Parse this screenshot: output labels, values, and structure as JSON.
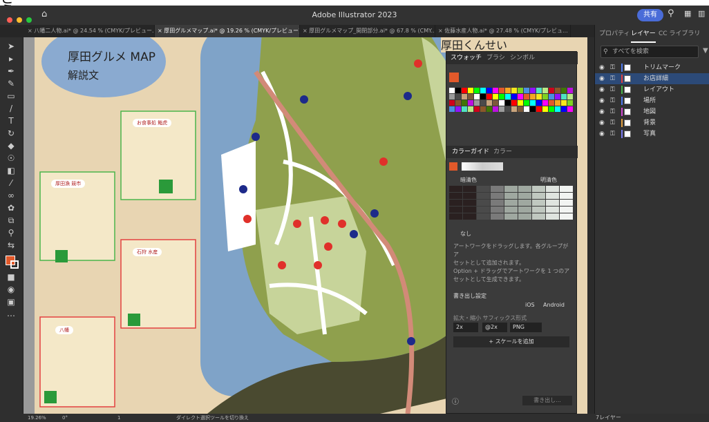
{
  "crop_text": "さう。",
  "app": {
    "title": "Adobe Illustrator 2023",
    "share_label": "共有"
  },
  "tabs": [
    {
      "label": "八幡二人物.ai* @ 24.54 % (CMYK/プレビュー...",
      "active": false
    },
    {
      "label": "厚田グルメマップ.ai* @ 19.26 % (CMYK/プレビュー)",
      "active": true
    },
    {
      "label": "厚田グルメマップ_開閉部分.ai* @ 67.8 % (CMY...",
      "active": false
    },
    {
      "label": "佐藤水産人物.ai* @ 27.48 % (CMYK/プレビュ...",
      "active": false
    }
  ],
  "right_panel": {
    "tabs": [
      "プロパティ",
      "レイヤー",
      "CC ライブラリ"
    ],
    "search_placeholder": "すべてを検索",
    "layers": [
      {
        "name": "トリムマーク",
        "color": "#4f7bf0",
        "selected": false
      },
      {
        "name": "お店詳細",
        "color": "#e34040",
        "selected": true
      },
      {
        "name": "レイアウト",
        "color": "#4ab54a",
        "selected": false
      },
      {
        "name": "場所",
        "color": "#4f7bf0",
        "selected": false
      },
      {
        "name": "地図",
        "color": "#d44ad4",
        "selected": false
      },
      {
        "name": "背景",
        "color": "#e3a040",
        "selected": false
      },
      {
        "name": "写真",
        "color": "#7b7bf0",
        "selected": false
      }
    ],
    "layer_count": "7レイヤー"
  },
  "swatch_panel": {
    "tabs": [
      "スウォッチ",
      "ブラシ",
      "シンボル"
    ],
    "color_guide_tabs": [
      "カラーガイド",
      "カラー"
    ],
    "dark_label": "暗清色",
    "light_label": "明清色",
    "none_label": "なし",
    "info_text1": "アートワークをドラッグします。各グループがア\nセットとして追加されます。",
    "info_text2": "Option + ドラッグでアートワークを 1 つのア\nセットとして生成できます。",
    "export_title": "書き出し設定",
    "ios": "iOS",
    "android": "Android",
    "scale_header": "拡大・縮小  サフィックス形式",
    "scale_value": "2x",
    "suffix_value": "@2x",
    "format_value": "PNG",
    "add_scale": "+ スケールを追加",
    "export_btn": "書き出し..."
  },
  "canvas": {
    "map_title": "厚田グルメ MAP",
    "map_subtitle": "解説文",
    "handwriting": "厚田くんせい",
    "card_title1": "お食事処 鮨虎",
    "card_title2": "厚田漁 競市",
    "card_title3": "石狩 水産",
    "card_title4": "八幡"
  },
  "status": {
    "zoom": "19.26%",
    "angle": "0°",
    "page": "1",
    "tool": "ダイレクト選択ツールを切り換え"
  },
  "colors": {
    "water": "#7fa3c8",
    "land": "#8fa04d",
    "road": "#ffffff",
    "rail": "#d28a78",
    "town": "#c7d49a",
    "dark": "#4a4a30",
    "red": "#e0302a",
    "navy": "#1d2a8a"
  }
}
